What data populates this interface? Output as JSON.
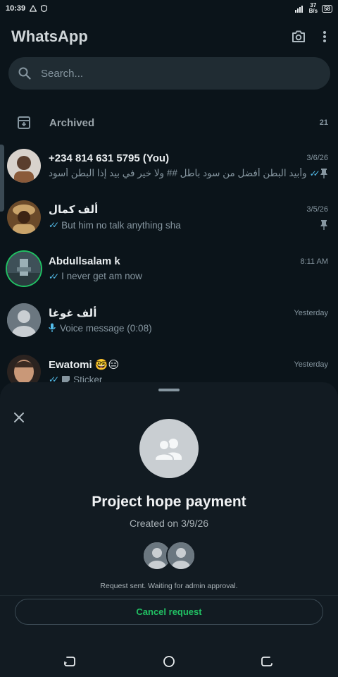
{
  "status_bar": {
    "time": "10:39",
    "network_speed_value": "37",
    "network_speed_unit": "B/s",
    "battery": "58"
  },
  "header": {
    "title": "WhatsApp"
  },
  "search": {
    "placeholder": "Search..."
  },
  "archived": {
    "label": "Archived",
    "count": "21"
  },
  "chats": [
    {
      "name": "+234 814 631 5795 (You)",
      "time": "3/6/26",
      "preview": "وأبيد البطن أفضل من سود باطل ## ولا خير في بيد إذا البطن أسود",
      "pinned": true
    },
    {
      "name": "ألف كمال",
      "time": "3/5/26",
      "preview": "But him no talk anything sha",
      "pinned": true
    },
    {
      "name": "Abdullsalam k",
      "time": "8:11 AM",
      "preview": "I never get am now",
      "pinned": false
    },
    {
      "name": "ألف غوغا",
      "time": "Yesterday",
      "preview": "Voice message (0:08)",
      "pinned": false
    },
    {
      "name": "Ewatomi 🤓😑",
      "time": "Yesterday",
      "preview": "Sticker",
      "pinned": false
    }
  ],
  "sheet": {
    "group_name": "Project hope payment",
    "created": "Created on 3/9/26",
    "status": "Request sent. Waiting for admin approval.",
    "cancel_label": "Cancel request"
  },
  "colors": {
    "background": "#0b141a",
    "accent_green": "#21c063",
    "read_ticks": "#53bdeb",
    "muted_text": "#8696a0"
  }
}
